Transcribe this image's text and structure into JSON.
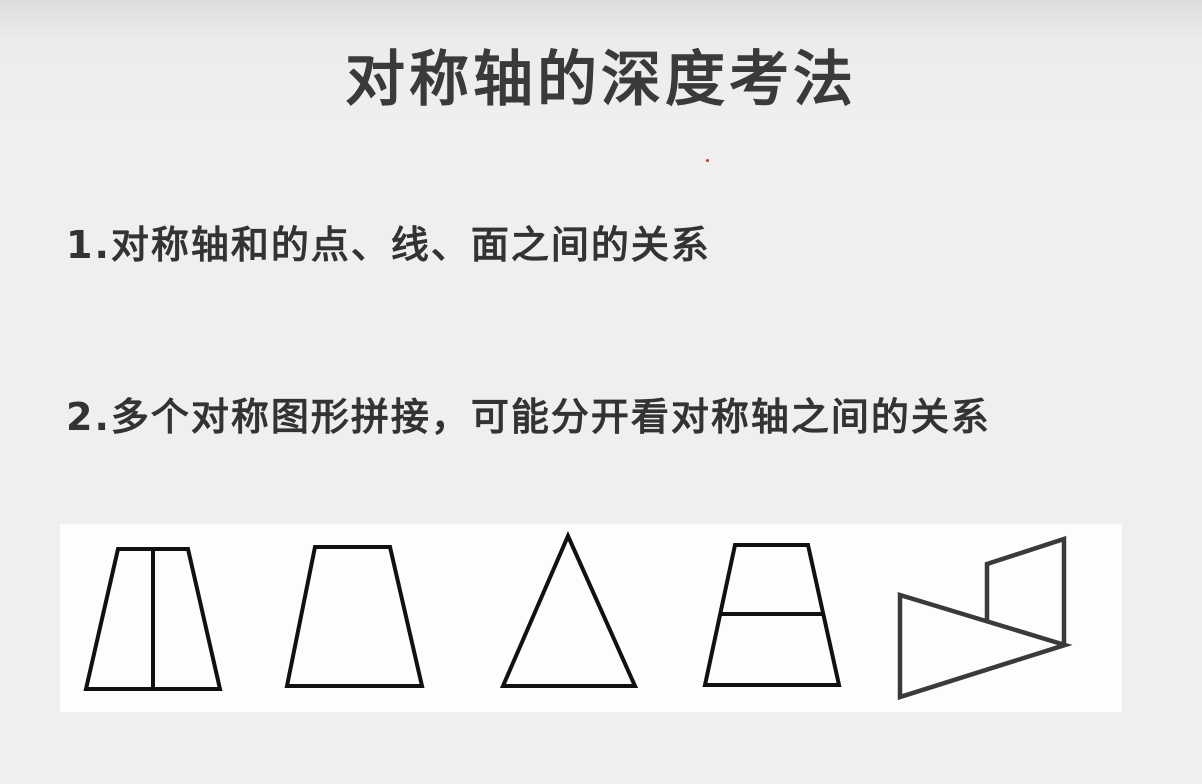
{
  "title": "对称轴的深度考法",
  "points": [
    {
      "label": "1.对称轴和的点、线、面之间的关系"
    },
    {
      "label": "2.多个对称图形拼接，可能分开看对称轴之间的关系"
    }
  ],
  "figures": [
    {
      "name": "trapezoid-with-vertical-line"
    },
    {
      "name": "trapezoid"
    },
    {
      "name": "triangle"
    },
    {
      "name": "trapezoid-with-horizontal-line"
    },
    {
      "name": "triangle-and-parallelogram"
    }
  ]
}
